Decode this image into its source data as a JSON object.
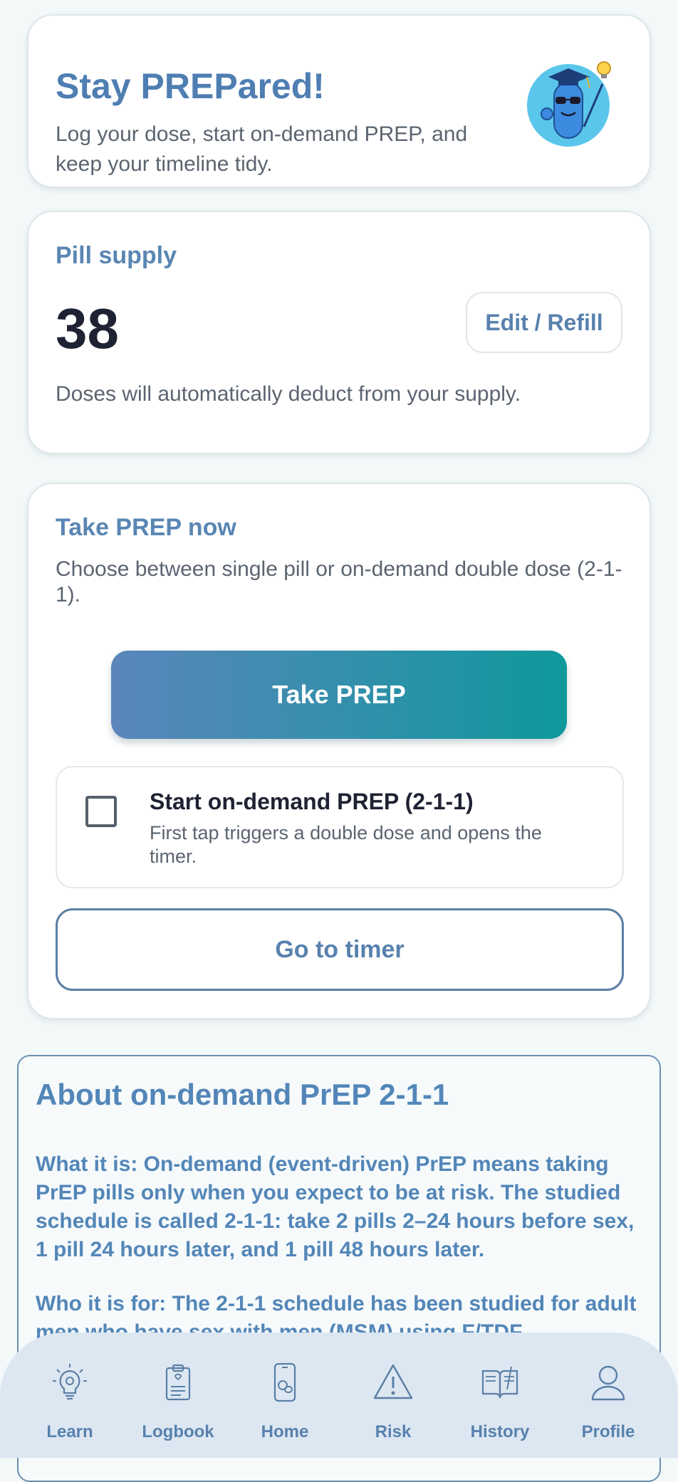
{
  "hero": {
    "title": "Stay PREPared!",
    "text": "Log your dose, start on-demand PREP, and keep your timeline tidy."
  },
  "supply": {
    "title": "Pill supply",
    "count": "38",
    "edit_label": "Edit / Refill",
    "note": "Doses will automatically deduct from your supply."
  },
  "take": {
    "title": "Take PREP now",
    "desc": "Choose between single pill or on-demand double dose (2-1-1).",
    "primary_label": "Take PREP",
    "checkbox_title": "Start on-demand PREP (2-1-1)",
    "checkbox_sub": "First tap triggers a double dose and opens the timer.",
    "timer_label": "Go to timer"
  },
  "about": {
    "title": "About on-demand PrEP 2-1-1",
    "p1": "What it is: On-demand (event-driven) PrEP means taking PrEP pills only when you expect to be at risk. The studied schedule is called 2-1-1: take 2 pills 2–24 hours before sex, 1 pill 24 hours later, and 1 pill 48 hours later.",
    "p2": "Who it is for: The 2-1-1 schedule has been studied for adult men who have sex with men (MSM) using F/TDF"
  },
  "nav": {
    "items": [
      {
        "label": "Learn",
        "icon": "lightbulb-icon"
      },
      {
        "label": "Logbook",
        "icon": "clipboard-icon"
      },
      {
        "label": "Home",
        "icon": "phone-pill-icon"
      },
      {
        "label": "Risk",
        "icon": "warning-icon"
      },
      {
        "label": "History",
        "icon": "book-icon"
      },
      {
        "label": "Profile",
        "icon": "user-icon"
      }
    ]
  },
  "colors": {
    "accent": "#5881ad",
    "gradient_start": "#5b86bb",
    "gradient_end": "#0f989c",
    "nav_bg": "#dce7f2"
  }
}
